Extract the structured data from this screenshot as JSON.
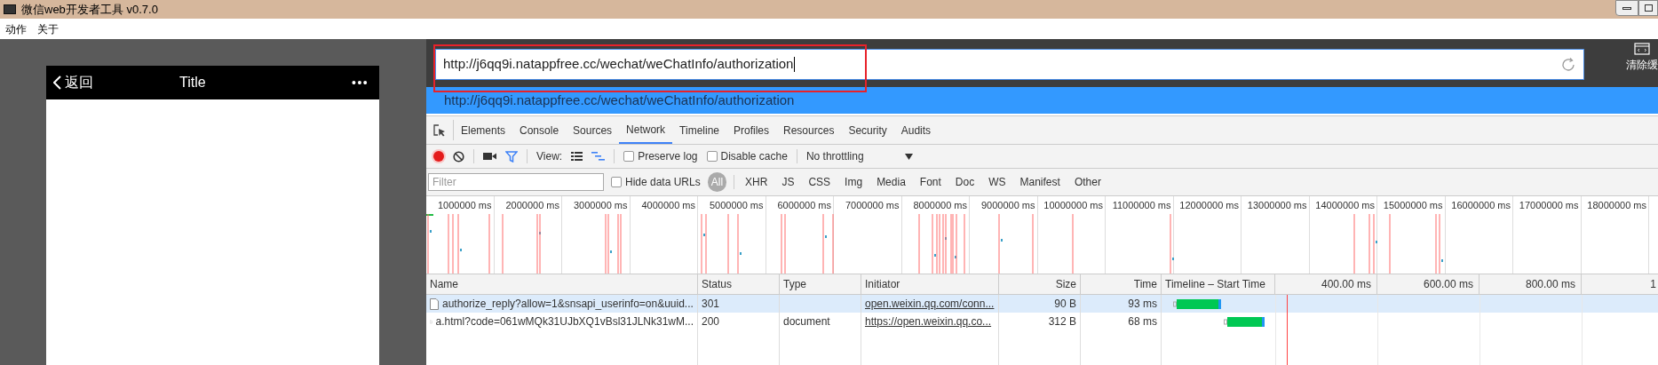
{
  "window": {
    "title": "微信web开发者工具 v0.7.0"
  },
  "menu": [
    "动作",
    "关于"
  ],
  "phone": {
    "back": "返回",
    "title": "Title",
    "more": "•••"
  },
  "address": {
    "value": "http://j6qq9i.natappfree.cc/wechat/weChatInfo/authorization",
    "suggestion": "http://j6qq9i.natappfree.cc/wechat/weChatInfo/authorization",
    "highlighted": true
  },
  "side_button": {
    "label": "清除缓"
  },
  "devtools": {
    "tabs": [
      {
        "label": "Elements",
        "selected": false
      },
      {
        "label": "Console",
        "selected": false
      },
      {
        "label": "Sources",
        "selected": false
      },
      {
        "label": "Network",
        "selected": true
      },
      {
        "label": "Timeline",
        "selected": false
      },
      {
        "label": "Profiles",
        "selected": false
      },
      {
        "label": "Resources",
        "selected": false
      },
      {
        "label": "Security",
        "selected": false
      },
      {
        "label": "Audits",
        "selected": false
      }
    ],
    "toolbar": {
      "recording": true,
      "filter_on": true,
      "view_label": "View:",
      "preserve_log": {
        "label": "Preserve log",
        "checked": false
      },
      "disable_cache": {
        "label": "Disable cache",
        "checked": false
      },
      "throttling": "No throttling"
    },
    "filter": {
      "placeholder": "Filter",
      "hide_data_urls": {
        "label": "Hide data URLs",
        "checked": false
      },
      "types": [
        {
          "label": "All",
          "selected": true
        },
        {
          "label": "XHR",
          "selected": false
        },
        {
          "label": "JS",
          "selected": false
        },
        {
          "label": "CSS",
          "selected": false
        },
        {
          "label": "Img",
          "selected": false
        },
        {
          "label": "Media",
          "selected": false
        },
        {
          "label": "Font",
          "selected": false
        },
        {
          "label": "Doc",
          "selected": false
        },
        {
          "label": "WS",
          "selected": false
        },
        {
          "label": "Manifest",
          "selected": false
        },
        {
          "label": "Other",
          "selected": false
        }
      ]
    },
    "overview_ticks": [
      "1000000 ms",
      "2000000 ms",
      "3000000 ms",
      "4000000 ms",
      "5000000 ms",
      "6000000 ms",
      "7000000 ms",
      "8000000 ms",
      "9000000 ms",
      "10000000 ms",
      "11000000 ms",
      "12000000 ms",
      "13000000 ms",
      "14000000 ms",
      "15000000 ms",
      "16000000 ms",
      "17000000 ms",
      "18000000 ms"
    ],
    "table": {
      "columns": [
        "Name",
        "Status",
        "Type",
        "Initiator",
        "Size",
        "Time",
        "Timeline – Start Time"
      ],
      "timeline_ticks": [
        "400.00 ms",
        "600.00 ms",
        "800.00 ms",
        "1"
      ],
      "rows": [
        {
          "name": "authorize_reply?allow=1&snsapi_userinfo=on&uuid...",
          "status": "301",
          "type": "",
          "initiator": "open.weixin.qq.com/conn...",
          "size": "90 B",
          "time": "93 ms",
          "selected": true
        },
        {
          "name": "a.html?code=061wMQk31UJbXQ1vBsl31JLNk31wM...",
          "status": "200",
          "type": "document",
          "initiator": "https://open.weixin.qq.co...",
          "size": "312 B",
          "time": "68 ms",
          "selected": false
        }
      ]
    }
  }
}
